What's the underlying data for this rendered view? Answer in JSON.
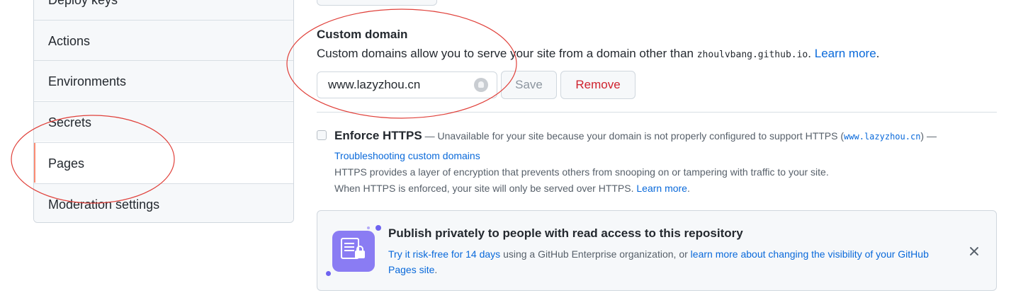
{
  "sidebar": {
    "items": [
      {
        "label": "Deploy keys"
      },
      {
        "label": "Actions"
      },
      {
        "label": "Environments"
      },
      {
        "label": "Secrets"
      },
      {
        "label": "Pages",
        "selected": true
      },
      {
        "label": "Moderation settings"
      }
    ],
    "accent_color": "#fd8c73"
  },
  "custom_domain": {
    "title": "Custom domain",
    "description_prefix": "Custom domains allow you to serve your site from a domain other than",
    "default_domain": "zhoulvbang.github.io",
    "description_suffix": ".",
    "learn_more": "Learn more",
    "input_value": "www.lazyzhou.cn",
    "input_icon": "github-icon",
    "save_label": "Save",
    "remove_label": "Remove"
  },
  "enforce_https": {
    "label": "Enforce HTTPS",
    "checked": false,
    "note_prefix": " — Unavailable for your site because your domain is not properly configured to support HTTPS (",
    "domain": "www.lazyzhou.cn",
    "note_suffix": ") —",
    "troubleshoot_link": "Troubleshooting custom domains",
    "help_line1": "HTTPS provides a layer of encryption that prevents others from snooping on or tampering with traffic to your site.",
    "help_line2": "When HTTPS is enforced, your site will only be served over HTTPS.",
    "learn_more": "Learn more",
    "help_line2_suffix": "."
  },
  "promo": {
    "title": "Publish privately to people with read access to this repository",
    "try_link": "Try it risk-free for 14 days",
    "text_middle": " using a GitHub Enterprise organization, or ",
    "learn_link": "learn more about changing the visibility of your GitHub Pages site",
    "text_end": ".",
    "icon": "private-pages-icon",
    "close_icon": "close-icon"
  },
  "colors": {
    "link": "#0969da",
    "danger": "#cf222e",
    "annotation": "#e0403a"
  }
}
